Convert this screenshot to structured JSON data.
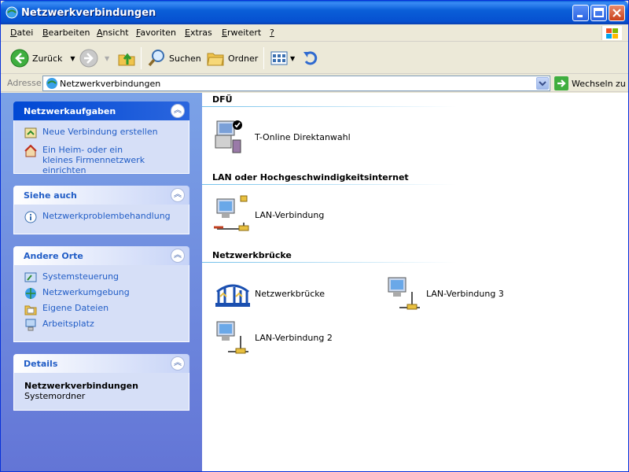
{
  "window": {
    "title": "Netzwerkverbindungen"
  },
  "menu": [
    {
      "label": "Datei",
      "accel": "D",
      "rest": "atei"
    },
    {
      "label": "Bearbeiten",
      "accel": "B",
      "rest": "earbeiten"
    },
    {
      "label": "Ansicht",
      "accel": "A",
      "rest": "nsicht"
    },
    {
      "label": "Favoriten",
      "accel": "F",
      "rest": "avoriten"
    },
    {
      "label": "Extras",
      "accel": "E",
      "rest": "xtras"
    },
    {
      "label": "Erweitert",
      "accel": "E",
      "rest": "rweitert"
    },
    {
      "label": "?",
      "accel": "?",
      "rest": ""
    }
  ],
  "toolbar": {
    "back_label": "Zurück",
    "search_label": "Suchen",
    "folders_label": "Ordner"
  },
  "address": {
    "label": "Adresse",
    "value": "Netzwerkverbindungen",
    "go_label": "Wechseln zu"
  },
  "tasks": {
    "network": {
      "title": "Netzwerkaufgaben",
      "items": [
        "Neue Verbindung erstellen",
        "Ein Heim- oder ein kleines Firmennetzwerk einrichten"
      ]
    },
    "see_also": {
      "title": "Siehe auch",
      "items": [
        "Netzwerkproblembehandlung"
      ]
    },
    "other_places": {
      "title": "Andere Orte",
      "items": [
        "Systemsteuerung",
        "Netzwerkumgebung",
        "Eigene Dateien",
        "Arbeitsplatz"
      ]
    },
    "details": {
      "title": "Details",
      "name": "Netzwerkverbindungen",
      "type": "Systemordner"
    }
  },
  "groups": [
    {
      "title": "DFÜ",
      "items": [
        "T-Online Direktanwahl"
      ]
    },
    {
      "title": "LAN oder Hochgeschwindigkeitsinternet",
      "items": [
        "LAN-Verbindung"
      ]
    },
    {
      "title": "Netzwerkbrücke",
      "items": [
        "Netzwerkbrücke",
        "LAN-Verbindung 3",
        "LAN-Verbindung 2"
      ]
    }
  ]
}
